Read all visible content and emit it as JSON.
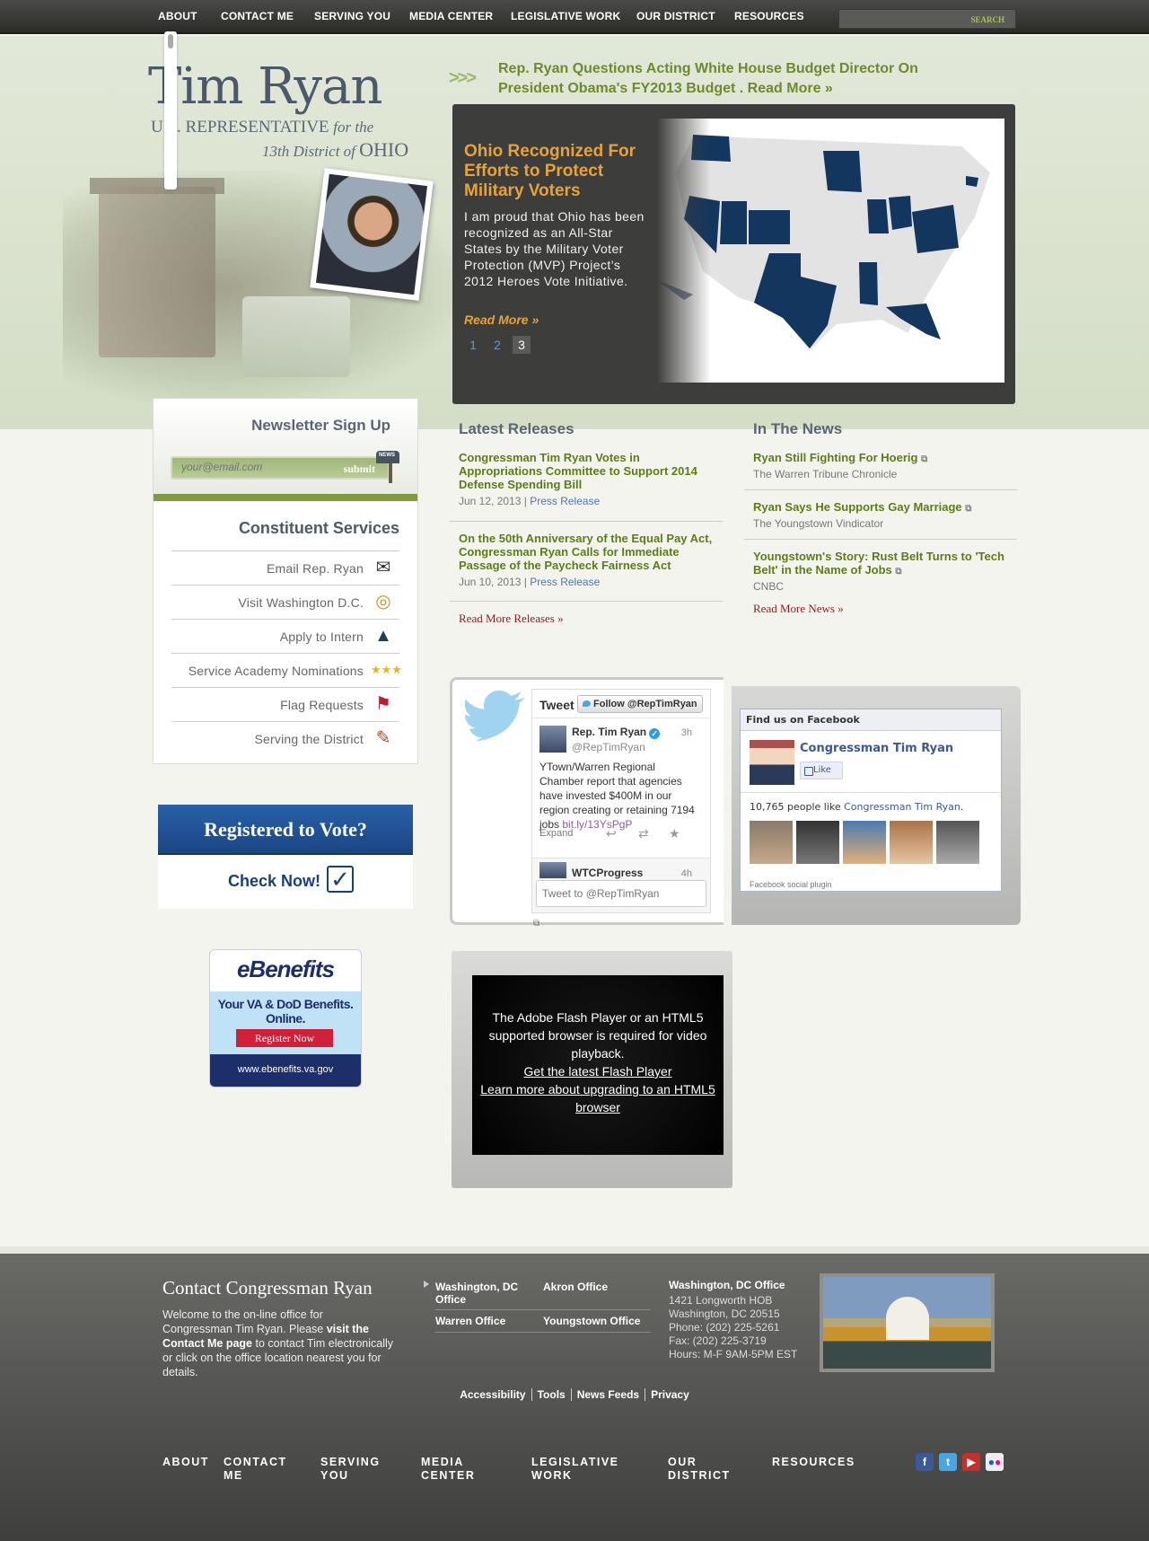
{
  "nav": {
    "items": [
      "ABOUT",
      "CONTACT ME",
      "SERVING YOU",
      "MEDIA CENTER",
      "LEGISLATIVE WORK",
      "OUR DISTRICT",
      "RESOURCES"
    ],
    "search_button": "SEARCH"
  },
  "header": {
    "name": "Tim Ryan",
    "subtitle_line1_a": "U.S. REPRESENTATIVE",
    "subtitle_line1_b": "for the",
    "subtitle_line2_a": "13th District of",
    "subtitle_line2_b": "OHIO"
  },
  "headline": {
    "arrows": ">>>",
    "text": "Rep. Ryan Questions Acting White House Budget Director On President Obama's FY2013 Budget . Read More »"
  },
  "slider": {
    "title": "Ohio Recognized For Efforts to Protect Military Voters",
    "body": "I am proud that Ohio has been recognized as an All-Star States by the Military Voter Protection (MVP) Project’s 2012 Heroes Vote Initiative.",
    "read_more": "Read More »",
    "pages": [
      "1",
      "2",
      "3"
    ],
    "active_page": "3"
  },
  "newsletter": {
    "title": "Newsletter Sign Up",
    "placeholder": "your@email.com",
    "submit": "submit",
    "mailbox_label": "NEWS"
  },
  "constituent": {
    "title": "Constituent Services",
    "items": [
      "Email Rep. Ryan",
      "Visit Washington D.C.",
      "Apply to Intern",
      "Service Academy Nominations",
      "Flag Requests",
      "Serving the District"
    ]
  },
  "register": {
    "title": "Registered to Vote?",
    "cta": "Check Now!"
  },
  "ebenefits": {
    "logo": "eBenefits",
    "tagline": "Your VA & DoD Benefits. Online.",
    "button": "Register Now",
    "url": "www.ebenefits.va.gov"
  },
  "releases": {
    "title": "Latest Releases",
    "items": [
      {
        "title": "Congressman Tim Ryan Votes in Appropriations Committee to Support 2014 Defense Spending Bill",
        "date": "Jun 12, 2013",
        "type": "Press Release"
      },
      {
        "title": "On the 50th Anniversary of the Equal Pay Act, Congressman Ryan Calls for Immediate Passage of the Paycheck Fairness Act",
        "date": "Jun 10, 2013",
        "type": "Press Release"
      }
    ],
    "more": "Read More Releases »"
  },
  "news": {
    "title": "In The News",
    "items": [
      {
        "title": "Ryan Still Fighting For Hoerig",
        "source": "The Warren Tribune Chronicle"
      },
      {
        "title": "Ryan Says He Supports Gay Marriage",
        "source": "The Youngstown Vindicator"
      },
      {
        "title": "Youngstown's Story: Rust Belt Turns to 'Tech Belt' in the Name of Jobs",
        "source": "CNBC"
      }
    ],
    "more": "Read More News »"
  },
  "twitter": {
    "header": "Tweet",
    "follow": "Follow @RepTimRyan",
    "name": "Rep. Tim Ryan",
    "handle": "@RepTimRyan",
    "time": "3h",
    "text": "YTown/Warren Regional Chamber report that agencies have invested $400M in our region creating or retaining 7194 jobs ",
    "link": "bit.ly/13YsPgP",
    "expand": "Expand",
    "next_name": "WTCProgress",
    "next_time": "4h",
    "compose_placeholder": "Tweet to @RepTimRyan"
  },
  "facebook": {
    "header": "Find us on Facebook",
    "page_name": "Congressman Tim Ryan",
    "like": "Like",
    "count_text": "10,765 people like ",
    "count_link": "Congressman Tim Ryan",
    "plugin": "Facebook social plugin"
  },
  "video": {
    "message": "The Adobe Flash Player or an HTML5 supported browser is required for video playback.",
    "link1": "Get the latest Flash Player",
    "link2": "Learn more about upgrading to an HTML5 browser"
  },
  "footer": {
    "title": "Contact Congressman Ryan",
    "text_a": "Welcome to the on-line office for Congressman Tim Ryan. Please ",
    "text_b": "visit the Contact Me page",
    "text_c": " to contact Tim electronically or click on the office location nearest you for details.",
    "offices": [
      "Washington, DC Office",
      "Akron Office",
      "Warren Office",
      "Youngstown Office"
    ],
    "dc_title": "Washington, DC Office",
    "dc_lines": [
      "1421 Longworth HOB",
      "Washington, DC 20515",
      "Phone: (202) 225-5261",
      "Fax: (202) 225-3719",
      "Hours: M-F 9AM-5PM EST"
    ],
    "links": [
      "Accessibility",
      "Tools",
      "News Feeds",
      "Privacy"
    ],
    "nav": [
      "ABOUT",
      "CONTACT ME",
      "SERVING YOU",
      "MEDIA CENTER",
      "LEGISLATIVE WORK",
      "OUR DISTRICT",
      "RESOURCES"
    ],
    "social": [
      "facebook-icon",
      "twitter-icon",
      "youtube-icon",
      "flickr-icon"
    ]
  },
  "colors": {
    "brand_green": "#6e8a2f",
    "slider_accent": "#e7a23b",
    "map_state": "#13365e",
    "nav_bg": "#333331"
  }
}
